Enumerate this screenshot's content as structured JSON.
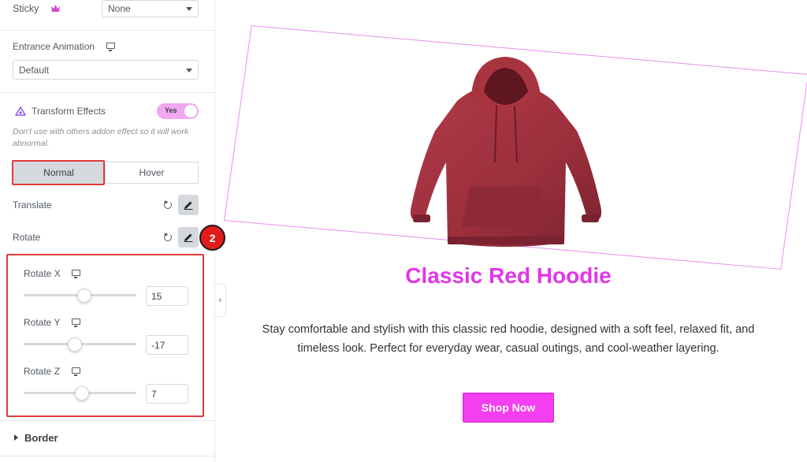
{
  "panel": {
    "sticky": {
      "label": "Sticky",
      "value": "None"
    },
    "entrance": {
      "label": "Entrance Animation",
      "value": "Default"
    },
    "transform": {
      "label": "Transform Effects",
      "toggle_label": "Yes",
      "note": "Don't use with others addon effect so it will work abnormal."
    },
    "tabs": [
      {
        "label": "Normal",
        "active": true
      },
      {
        "label": "Hover",
        "active": false
      }
    ],
    "translate_label": "Translate",
    "rotate_label": "Rotate",
    "step_badge": "2",
    "rotate_x": {
      "label": "Rotate X",
      "value": "15"
    },
    "rotate_y": {
      "label": "Rotate Y",
      "value": "-17"
    },
    "rotate_z": {
      "label": "Rotate Z",
      "value": "7"
    },
    "border_label": "Border",
    "collapse_glyph": "‹"
  },
  "preview": {
    "title": "Classic Red Hoodie",
    "description_line1": "Stay comfortable and stylish with this classic red hoodie, designed with a soft feel, relaxed fit, and",
    "description_line2": "timeless look. Perfect for everyday wear, casual outings, and cool-weather layering.",
    "button_label": "Shop Now"
  },
  "colors": {
    "accent": "#e236e8",
    "button": "#f33ff0",
    "highlight": "#e03b3b",
    "hoodie": "#9b2f3c"
  },
  "icons": [
    "crown-icon",
    "monitor-icon",
    "transform-effects-icon",
    "reset-icon",
    "pencil-icon",
    "caret-down-icon",
    "chevron-left-icon",
    "caret-right-icon"
  ]
}
